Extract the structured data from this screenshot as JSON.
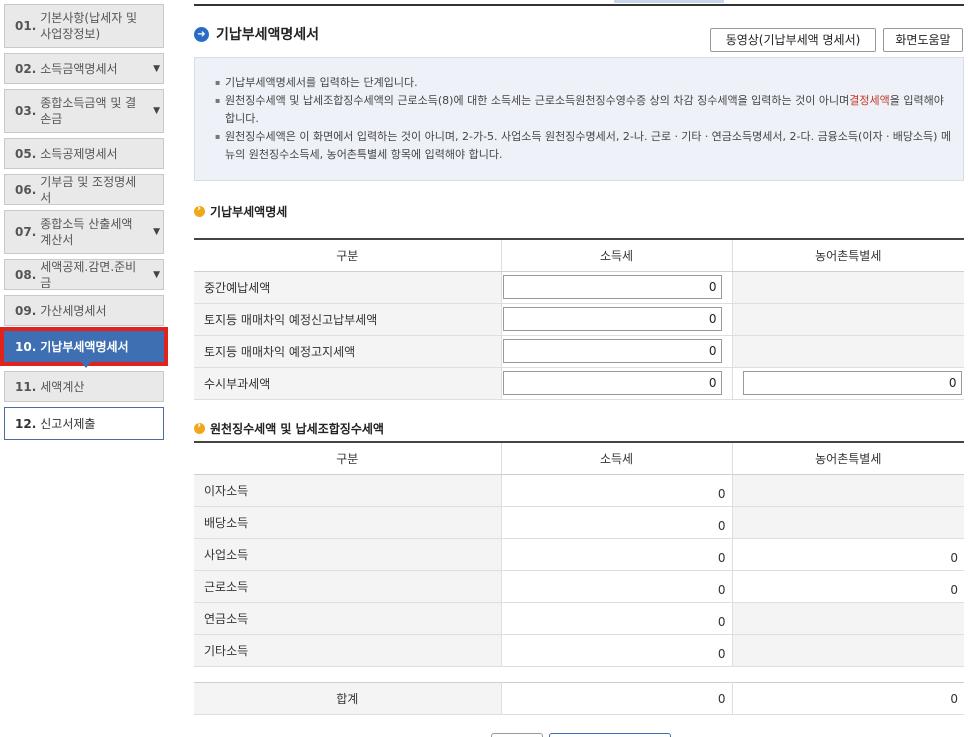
{
  "sidebar": {
    "items": [
      {
        "num": "01.",
        "label": "기본사항(납세자 및 사업장정보)",
        "chevron": false
      },
      {
        "num": "02.",
        "label": "소득금액명세서",
        "chevron": true
      },
      {
        "num": "03.",
        "label": "종합소득금액 및 결손금",
        "chevron": true
      },
      {
        "num": "05.",
        "label": "소득공제명세서",
        "chevron": false
      },
      {
        "num": "06.",
        "label": "기부금 및 조정명세서",
        "chevron": false
      },
      {
        "num": "07.",
        "label": "종합소득 산출세액계산서",
        "chevron": true
      },
      {
        "num": "08.",
        "label": "세액공제.감면.준비금",
        "chevron": true
      },
      {
        "num": "09.",
        "label": "가산세명세서",
        "chevron": false
      },
      {
        "num": "10.",
        "label": "기납부세액명세서",
        "chevron": false
      },
      {
        "num": "11.",
        "label": "세액계산",
        "chevron": false
      },
      {
        "num": "12.",
        "label": "신고서제출",
        "chevron": false
      }
    ]
  },
  "header": {
    "title": "기납부세액명세서",
    "video_button": "동영상(기납부세액 명세서)",
    "help_button": "화면도움말"
  },
  "info": {
    "line1": "기납부세액명세서를 입력하는 단계입니다.",
    "line2a": "원천징수세액 및 납세조합징수세액의 근로소득(8)에 대한 소득세는 근로소득원천징수영수증 상의 차감 징수세액을 입력하는 것이 아니며",
    "line2red": "결정세액",
    "line2b": "을 입력해야 합니다.",
    "line3": "원천징수세액은 이 화면에서 입력하는 것이 아니며, 2-가-5. 사업소득 원천징수명세서, 2-나. 근로ㆍ기타ㆍ연금소득명세서, 2-다. 금융소득(이자ㆍ배당소득) 메뉴의 원천징수소득세, 농어촌특별세 항목에 입력해야 합니다."
  },
  "section1": {
    "title": "기납부세액명세",
    "headers": [
      "구분",
      "소득세",
      "농어촌특별세"
    ],
    "rows": [
      {
        "label": "중간예납세액",
        "income_tax": "0"
      },
      {
        "label": "토지등 매매차익 예정신고납부세액",
        "income_tax": "0"
      },
      {
        "label": "토지등 매매차익 예정고지세액",
        "income_tax": "0"
      },
      {
        "label": "수시부과세액",
        "income_tax": "0",
        "rural_tax": "0"
      }
    ]
  },
  "section2": {
    "title": "원천징수세액 및 납세조합징수세액",
    "headers": [
      "구분",
      "소득세",
      "농어촌특별세"
    ],
    "rows": [
      {
        "label": "이자소득",
        "income_tax": "0",
        "rural_tax": ""
      },
      {
        "label": "배당소득",
        "income_tax": "0",
        "rural_tax": ""
      },
      {
        "label": "사업소득",
        "income_tax": "0",
        "rural_tax": "0"
      },
      {
        "label": "근로소득",
        "income_tax": "0",
        "rural_tax": "0"
      },
      {
        "label": "연금소득",
        "income_tax": "0",
        "rural_tax": ""
      },
      {
        "label": "기타소득",
        "income_tax": "0",
        "rural_tax": ""
      }
    ],
    "total_label": "합계",
    "total_income_tax": "0",
    "total_rural_tax": "0"
  },
  "colors": {
    "accent": "#3f6fb3",
    "highlight": "#e0241d",
    "section_icon": "#f0a81a"
  }
}
